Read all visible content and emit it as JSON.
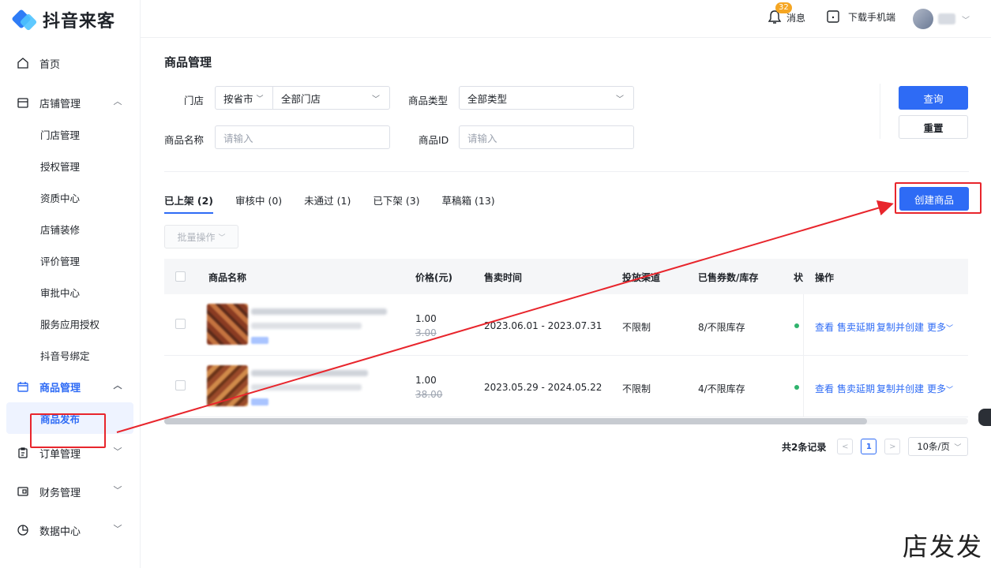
{
  "brand": {
    "name": "抖音来客"
  },
  "topbar": {
    "notif_count": "32",
    "notif_label": "消息",
    "download_label": "下载手机端"
  },
  "sidebar": {
    "items": [
      {
        "label": "首页"
      },
      {
        "label": "店铺管理"
      },
      {
        "label": "门店管理"
      },
      {
        "label": "授权管理"
      },
      {
        "label": "资质中心"
      },
      {
        "label": "店铺装修"
      },
      {
        "label": "评价管理"
      },
      {
        "label": "审批中心"
      },
      {
        "label": "服务应用授权"
      },
      {
        "label": "抖音号绑定"
      },
      {
        "label": "商品管理"
      },
      {
        "label": "商品发布"
      },
      {
        "label": "订单管理"
      },
      {
        "label": "财务管理"
      },
      {
        "label": "数据中心"
      }
    ]
  },
  "page": {
    "title": "商品管理"
  },
  "filters": {
    "store_label": "门店",
    "store_region": "按省市",
    "store_value": "全部门店",
    "type_label": "商品类型",
    "type_value": "全部类型",
    "name_label": "商品名称",
    "name_placeholder": "请输入",
    "id_label": "商品ID",
    "id_placeholder": "请输入",
    "query_btn": "查询",
    "reset_btn": "重置"
  },
  "tabs": [
    {
      "label": "已上架 (2)"
    },
    {
      "label": "审核中 (0)"
    },
    {
      "label": "未通过 (1)"
    },
    {
      "label": "已下架 (3)"
    },
    {
      "label": "草稿箱 (13)"
    }
  ],
  "create_btn": "创建商品",
  "batch_btn": "批量操作",
  "table": {
    "headers": {
      "name": "商品名称",
      "price": "价格(元)",
      "time": "售卖时间",
      "channel": "投放渠道",
      "sold": "已售券数/库存",
      "status": "状",
      "ops": "操作"
    },
    "rows": [
      {
        "price": "1.00",
        "orig_price": "3.00",
        "time": "2023.06.01 - 2023.07.31",
        "channel": "不限制",
        "sold": "8/不限库存"
      },
      {
        "price": "1.00",
        "orig_price": "38.00",
        "time": "2023.05.29 - 2024.05.22",
        "channel": "不限制",
        "sold": "4/不限库存"
      }
    ],
    "ops": {
      "view": "查看",
      "extend": "售卖延期",
      "copy": "复制并创建",
      "more": "更多"
    }
  },
  "pagination": {
    "total": "共2条记录",
    "current": "1",
    "page_size": "10条/页"
  },
  "watermark": "店发发",
  "colors": {
    "primary": "#2e6bf5",
    "annotation": "#e8252c",
    "status_on": "#2fb36d"
  }
}
